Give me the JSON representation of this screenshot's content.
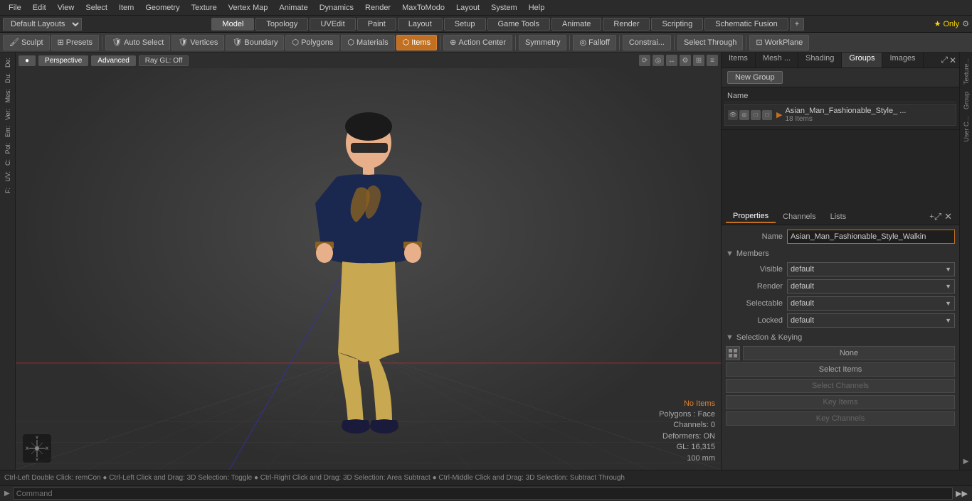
{
  "menu": {
    "items": [
      "File",
      "Edit",
      "View",
      "Select",
      "Item",
      "Geometry",
      "Texture",
      "Vertex Map",
      "Animate",
      "Dynamics",
      "Render",
      "MaxToModo",
      "Layout",
      "System",
      "Help"
    ]
  },
  "layout_bar": {
    "dropdown": "Default Layouts ▾",
    "tabs": [
      "Model",
      "Topology",
      "UVEdit",
      "Paint",
      "Layout",
      "Setup",
      "Game Tools",
      "Animate",
      "Render",
      "Scripting",
      "Schematic Fusion"
    ],
    "active_tab": "Model",
    "add_icon": "+",
    "star_label": "★ Only",
    "settings_icon": "⚙"
  },
  "tools_bar": {
    "sculpt": "Sculpt",
    "presets": "Presets",
    "auto_select": "Auto Select",
    "vertices": "Vertices",
    "boundary": "Boundary",
    "polygons": "Polygons",
    "materials": "Materials",
    "items": "Items",
    "action_center": "Action Center",
    "symmetry": "Symmetry",
    "falloff": "Falloff",
    "constraints": "Constrai...",
    "select_through": "Select Through",
    "workplane": "WorkPlane"
  },
  "viewport": {
    "perspective": "Perspective",
    "advanced": "Advanced",
    "ray_gl": "Ray GL: Off"
  },
  "left_sidebar": {
    "items": [
      "De:",
      "Du:",
      "Mes:",
      "Ver:",
      "Em:",
      "Pol:",
      "C:",
      "UV:",
      "F:"
    ]
  },
  "right_panel": {
    "tabs": [
      "Items",
      "Mesh ...",
      "Shading",
      "Groups",
      "Images"
    ],
    "active_tab": "Groups",
    "new_group_btn": "New Group",
    "name_header": "Name",
    "group_item": {
      "name": "Asian_Man_Fashionable_Style_ ...",
      "count": "18 Items"
    }
  },
  "properties": {
    "tabs": [
      "Properties",
      "Channels",
      "Lists"
    ],
    "active_tab": "Properties",
    "add_btn": "+",
    "name_label": "Name",
    "name_value": "Asian_Man_Fashionable_Style_Walkin",
    "members_section": "Members",
    "visible_label": "Visible",
    "visible_value": "default",
    "render_label": "Render",
    "render_value": "default",
    "selectable_label": "Selectable",
    "selectable_value": "default",
    "locked_label": "Locked",
    "locked_value": "default",
    "selection_keying_section": "Selection & Keying",
    "none_btn": "None",
    "select_items_btn": "Select Items",
    "select_channels_btn": "Select Channels",
    "key_items_btn": "Key Items",
    "key_channels_btn": "Key Channels"
  },
  "right_strip": {
    "items": [
      "Texture...",
      "Group",
      "User C..."
    ]
  },
  "viewport_status": {
    "no_items": "No Items",
    "polygons": "Polygons : Face",
    "channels": "Channels: 0",
    "deformers": "Deformers: ON",
    "gl": "GL: 16,315",
    "size": "100 mm"
  },
  "status_bar": {
    "text": "Ctrl-Left Double Click: remCon ● Ctrl-Left Click and Drag: 3D Selection: Toggle ● Ctrl-Right Click and Drag: 3D Selection: Area Subtract ● Ctrl-Middle Click and Drag: 3D Selection: Subtract Through"
  },
  "command_bar": {
    "placeholder": "Command",
    "arrow_label": "▶"
  }
}
